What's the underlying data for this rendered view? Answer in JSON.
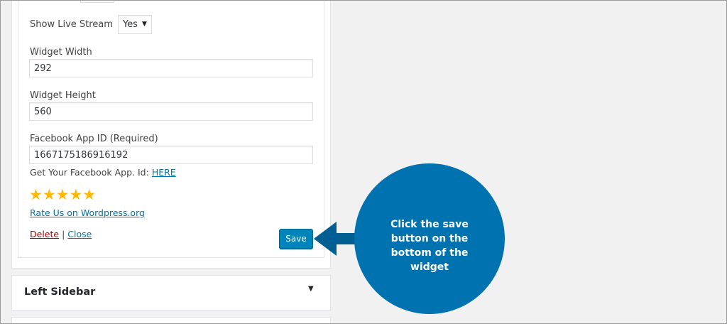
{
  "widget": {
    "live_stream": {
      "label": "Show Live Stream",
      "value": "Yes"
    },
    "width": {
      "label": "Widget Width",
      "value": "292"
    },
    "height": {
      "label": "Widget Height",
      "value": "560"
    },
    "app_id": {
      "label": "Facebook App ID (Required)",
      "value": "1667175186916192"
    },
    "get_id": {
      "text": "Get Your Facebook App. Id:",
      "link": "HERE"
    },
    "rating": {
      "stars": "★★★★★",
      "value": 5,
      "max": 5
    },
    "rate_link": "Rate Us on Wordpress.org",
    "delete_label": "Delete",
    "separator": "|",
    "close_label": "Close",
    "save_label": "Save"
  },
  "sidebar": {
    "title": "Left Sidebar",
    "toggle_icon": "triangle-down-icon"
  },
  "callout": {
    "text": "Click the save button on the bottom of the widget",
    "circle_color": "#0072b0",
    "arrow_color": "#005f92"
  },
  "colors": {
    "accent": "#0085ba",
    "link": "#0073aa",
    "delete": "#aa0000",
    "star": "#ffb900"
  }
}
